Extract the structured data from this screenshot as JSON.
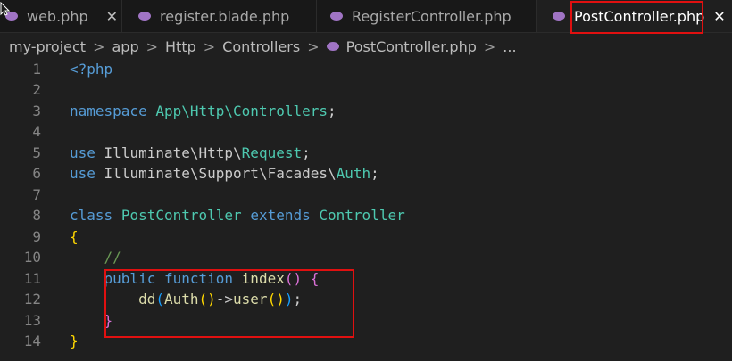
{
  "tabs": [
    {
      "label": "web.php",
      "active": false
    },
    {
      "label": "register.blade.php",
      "active": false
    },
    {
      "label": "RegisterController.php",
      "active": false
    },
    {
      "label": "PostController.php",
      "active": true
    }
  ],
  "close_glyph": "✕",
  "breadcrumb": {
    "items": [
      "my-project",
      "app",
      "Http",
      "Controllers",
      "PostController.php",
      "..."
    ],
    "separator": ">"
  },
  "code": {
    "line_numbers": [
      "1",
      "2",
      "3",
      "4",
      "5",
      "6",
      "7",
      "8",
      "9",
      "10",
      "11",
      "12",
      "13",
      "14"
    ],
    "line1": {
      "open_tag": "<?php"
    },
    "line3": {
      "kw": "namespace",
      "ns": "App\\Http\\Controllers",
      "semi": ";"
    },
    "line5": {
      "kw": "use",
      "path": "Illuminate\\Http\\",
      "cls": "Request",
      "semi": ";"
    },
    "line6": {
      "kw": "use",
      "path": "Illuminate\\Support\\Facades\\",
      "cls": "Auth",
      "semi": ";"
    },
    "line8": {
      "kw1": "class",
      "name": "PostController",
      "kw2": "extends",
      "parent": "Controller"
    },
    "line9": {
      "brace": "{"
    },
    "line10": {
      "comment": "//"
    },
    "line11": {
      "kw1": "public",
      "kw2": "function",
      "fn": "index",
      "parens": "()",
      "brace": "{"
    },
    "line12": {
      "fn": "dd",
      "p1": "(",
      "cls": "Auth",
      "p2": "()",
      "arrow": "->",
      "fn2": "user",
      "p3": "()",
      "p4": ")",
      "semi": ";"
    },
    "line13": {
      "brace": "}"
    },
    "line14": {
      "brace": "}"
    }
  },
  "colors": {
    "keyword": "#569cd6",
    "type": "#4ec9b0",
    "function": "#dcdcaa",
    "comment": "#6a9955",
    "highlight_box": "#e01010"
  }
}
